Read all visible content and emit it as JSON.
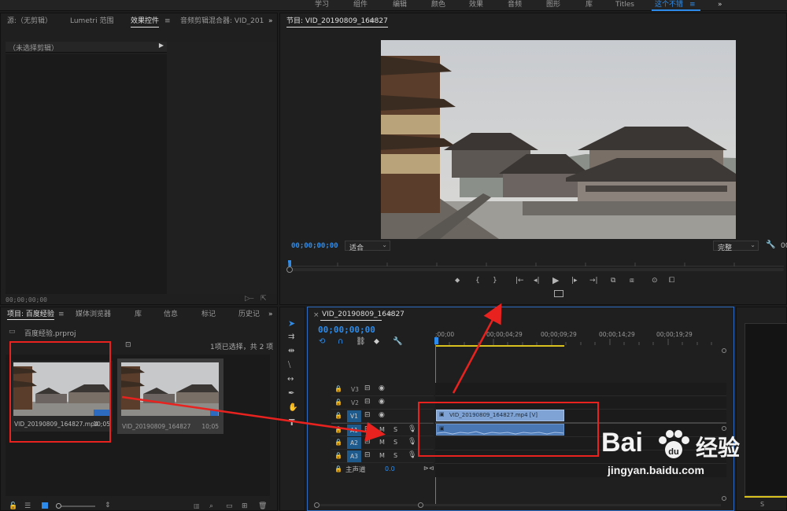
{
  "workspaces": [
    "学习",
    "组件",
    "编辑",
    "颜色",
    "效果",
    "音频",
    "图形",
    "库",
    "Titles"
  ],
  "active_workspace": "这个不错",
  "more_glyph": "»",
  "menu_glyph": "≡",
  "source_panel": {
    "tabs": [
      "源:（无剪辑）",
      "Lumetri 范围",
      "效果控件",
      "音频剪辑混合器: VID_201"
    ],
    "active_tab": "效果控件",
    "no_clip": "（未选择剪辑）",
    "timecode": "00;00;00;00"
  },
  "program_monitor": {
    "title": "节目: VID_20190809_164827",
    "timecode": "00;00;00;00",
    "fit": "适合",
    "quality": "完整",
    "right_tc": "00"
  },
  "project_panel": {
    "tabs": [
      "项目: 百度经验",
      "媒体浏览器",
      "库",
      "信息",
      "标记",
      "历史记"
    ],
    "project_file": "百度经验.prproj",
    "selection_info": "1项已选择，共 2 项",
    "items": [
      {
        "name": "VID_20190809_164827.mp4",
        "duration": "10;05"
      },
      {
        "name": "VID_20190809_164827",
        "duration": "10;05"
      }
    ]
  },
  "timeline": {
    "title": "VID_20190809_164827",
    "timecode": "00;00;00;00",
    "ruler_labels": [
      ";00;00",
      "00;00;04;29",
      "00;00;09;29",
      "00;00;14;29",
      "00;00;19;29"
    ],
    "video_tracks": [
      "V3",
      "V2",
      "V1"
    ],
    "audio_tracks": [
      "A1",
      "A2",
      "A3"
    ],
    "master_label": "主声道",
    "master_value": "0.0",
    "mute": "M",
    "solo": "S",
    "clip_label": "VID_20190809_164827.mp4 [V]"
  },
  "watermark": {
    "brand": "Bai",
    "brand2": "经验",
    "url": "jingyan.baidu.com"
  },
  "colors": {
    "accent": "#2d8ceb",
    "annotation": "#e8221e",
    "clip_video": "#7ea3d4",
    "clip_audio": "#4a78b5"
  }
}
